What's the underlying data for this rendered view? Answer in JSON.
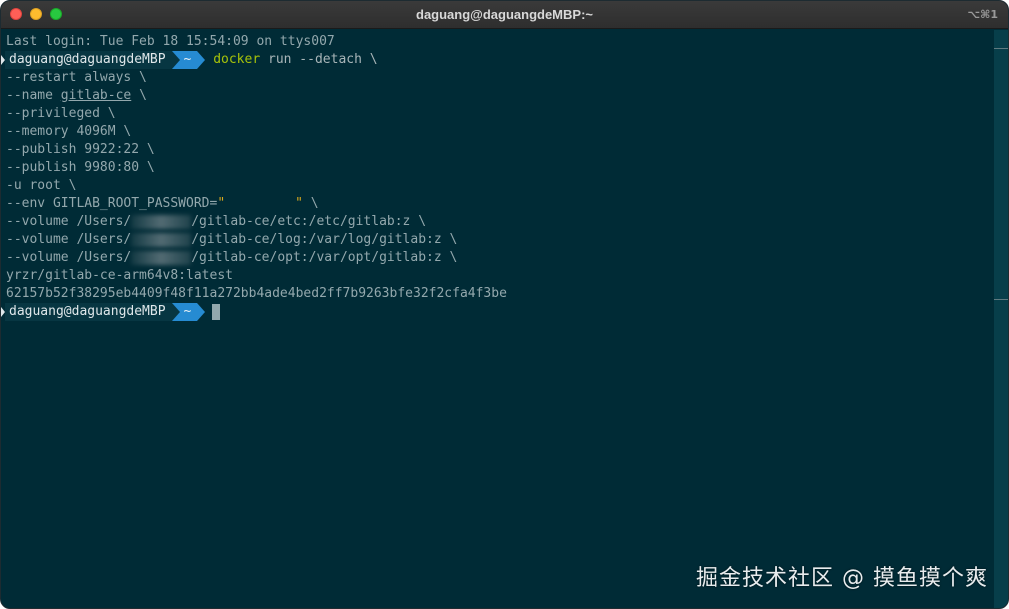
{
  "window": {
    "title": "daguang@daguangdeMBP:~",
    "shortcut": "⌥⌘1"
  },
  "terminal": {
    "last_login": "Last login: Tue Feb 18 15:54:09 on ttys007",
    "prompt_user": "daguang@daguangdeMBP",
    "prompt_dir": "~",
    "command_name": "docker",
    "command_rest": " run --detach \\",
    "lines": {
      "restart": "--restart always \\",
      "name_prefix": "--name ",
      "name_value": "gitlab-ce",
      "name_suffix": " \\",
      "privileged": "--privileged \\",
      "memory": "--memory 4096M \\",
      "publish1": "--publish 9922:22 \\",
      "publish2": "--publish 9980:80 \\",
      "user": "-u root \\",
      "env_prefix": "--env GITLAB_ROOT_PASSWORD=",
      "env_quote_open": "\"",
      "env_quote_close": "\"",
      "env_suffix": " \\",
      "vol_prefix": "--volume /Users/",
      "vol1_suffix": "/gitlab-ce/etc:/etc/gitlab:z \\",
      "vol2_suffix": "/gitlab-ce/log:/var/log/gitlab:z \\",
      "vol3_suffix": "/gitlab-ce/opt:/var/opt/gitlab:z \\",
      "image": "yrzr/gitlab-ce-arm64v8:latest",
      "container_id": "62157b52f38295eb4409f48f11a272bb4ade4bed2ff7b9263bfe32f2cfa4f3be"
    }
  },
  "watermark": "掘金技术社区 @ 摸鱼摸个爽",
  "colors": {
    "background": "#002b36",
    "prompt_user_bg": "#073642",
    "prompt_dir_bg": "#268bd2",
    "command": "#a6c20a",
    "string": "#d7a81e"
  }
}
